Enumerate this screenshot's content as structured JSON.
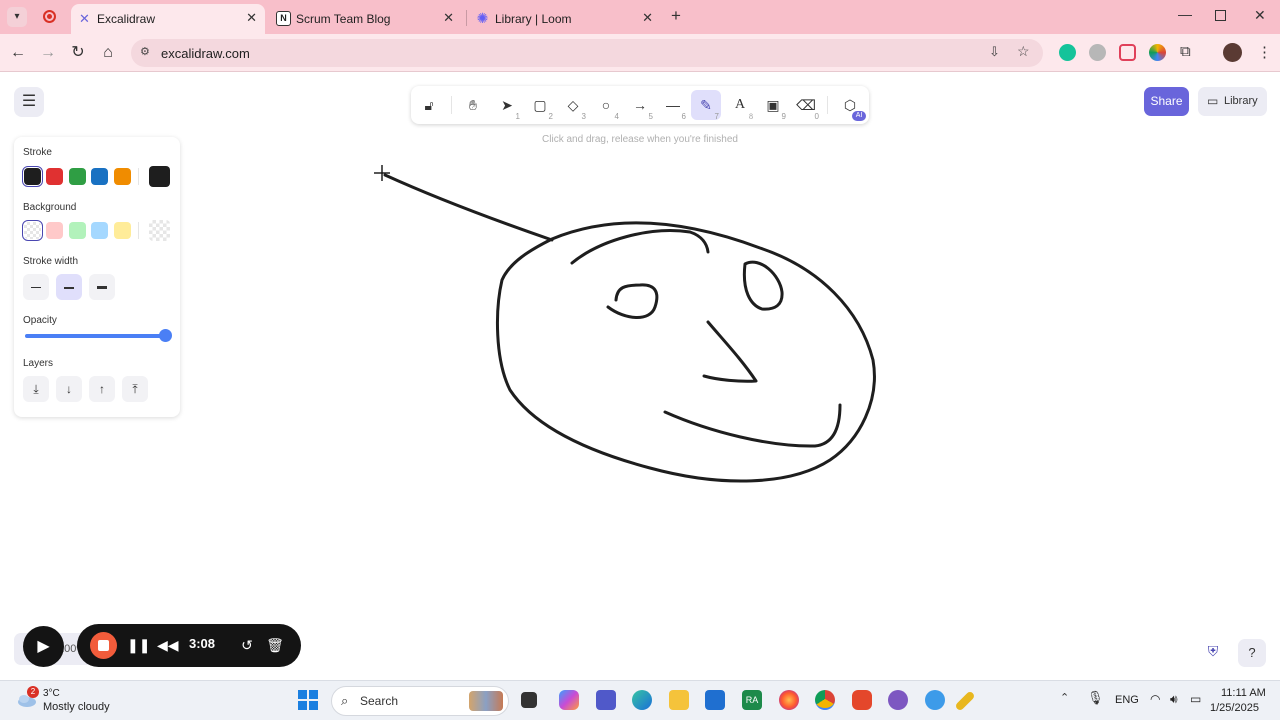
{
  "browser": {
    "tabs": [
      {
        "title": "Excalidraw",
        "icon": "excalidraw-icon",
        "active": true
      },
      {
        "title": "Scrum Team Blog",
        "icon": "notion-icon",
        "active": false
      },
      {
        "title": "Library | Loom",
        "icon": "loom-icon",
        "active": false
      }
    ],
    "url": "excalidraw.com"
  },
  "toolbar": {
    "tools": [
      {
        "name": "lock",
        "key": ""
      },
      {
        "name": "hand",
        "key": ""
      },
      {
        "name": "selection",
        "key": "1"
      },
      {
        "name": "rectangle",
        "key": "2"
      },
      {
        "name": "diamond",
        "key": "3"
      },
      {
        "name": "ellipse",
        "key": "4"
      },
      {
        "name": "arrow",
        "key": "5"
      },
      {
        "name": "line",
        "key": "6"
      },
      {
        "name": "draw",
        "key": "7",
        "active": true
      },
      {
        "name": "text",
        "key": "8"
      },
      {
        "name": "image",
        "key": "9"
      },
      {
        "name": "eraser",
        "key": "0"
      },
      {
        "name": "more-tools",
        "key": ""
      }
    ],
    "ai_badge": "AI",
    "hint": "Click and drag, release when you're finished"
  },
  "header": {
    "share_label": "Share",
    "library_label": "Library"
  },
  "properties": {
    "stroke_label": "Stroke",
    "stroke_colors": [
      "#1e1e1e",
      "#e03131",
      "#2f9e44",
      "#1971c2",
      "#f08c00"
    ],
    "stroke_current": "#1e1e1e",
    "background_label": "Background",
    "background_colors": [
      "transparent",
      "#ffc9c9",
      "#b2f2bb",
      "#a5d8ff",
      "#ffec99"
    ],
    "stroke_width_label": "Stroke width",
    "opacity_label": "Opacity",
    "opacity_value": 100,
    "layers_label": "Layers"
  },
  "footer": {
    "zoom": "100%"
  },
  "loom": {
    "timer": "3:08"
  },
  "taskbar": {
    "weather_badge": "2",
    "temperature": "3°C",
    "weather_desc": "Mostly cloudy",
    "search_label": "Search",
    "language": "ENG",
    "time": "11:11 AM",
    "date": "1/25/2025"
  }
}
